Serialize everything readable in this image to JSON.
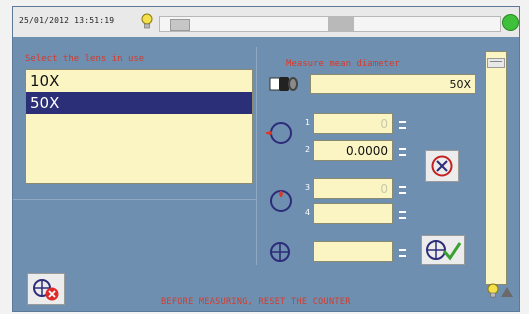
{
  "status_bar": {
    "datetime": "25/01/2012 13:51:19",
    "status_color": "#3fc03a"
  },
  "lens_panel": {
    "title": "Select the lens in use",
    "items": [
      {
        "label": "10X",
        "selected": false
      },
      {
        "label": "50X",
        "selected": true
      }
    ]
  },
  "measure_panel": {
    "title": "Measure mean diameter",
    "lens_value": "50X",
    "rows": [
      {
        "index": "1",
        "value": "0"
      },
      {
        "index": "2",
        "value": "0.0000"
      },
      {
        "index": "3",
        "value": "0"
      },
      {
        "index": "4",
        "value": ""
      }
    ],
    "result_value": ""
  },
  "warning": "BEFORE MEASURING, RESET THE COUNTER",
  "colors": {
    "screen_bg": "#6e8fb0",
    "field_bg": "#fbf5c4",
    "accent_red": "#d63a2a",
    "selection": "#2b2f78"
  },
  "icons": [
    "lightbulb-icon",
    "status-led-icon",
    "lens-icon",
    "circle-diameter-icon",
    "circle-crosshair-icon",
    "reset-cross-icon",
    "confirm-check-icon",
    "cancel-icon"
  ]
}
